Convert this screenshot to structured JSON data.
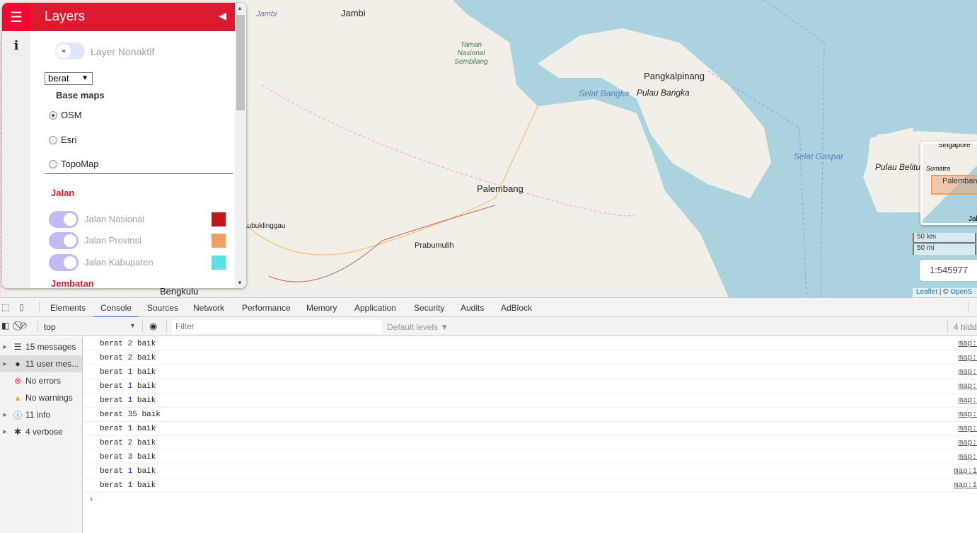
{
  "map": {
    "labels": {
      "jambi": "Jambi",
      "jambi2": "Jambi",
      "taman": "Taman Nasional Sembilang",
      "pangkalpinang": "Pangkalpinang",
      "pulau_bangka": "Pulau Bangka",
      "selat_bangka": "Selat Bangka",
      "selat_gaspar": "Selat Gaspar",
      "pulau_belitung": "Pulau Belitu",
      "palembang": "Palembang",
      "prabumulih": "Prabumulih",
      "lubuklinggau": "Lubuklinggau",
      "bengkulu": "Bengkulu"
    },
    "minimap": {
      "singapore": "Singapore",
      "sumatra": "Sumatra",
      "palembang": "Palemban",
      "jakarta": "Jak"
    },
    "scale": {
      "km": "50 km",
      "mi": "50 mi",
      "ratio": "1:545977"
    },
    "attribution": {
      "leaflet": "Leaflet",
      "sep": " | © ",
      "osm": "OpenS"
    },
    "colors": {
      "land": "#f2efe9",
      "sea": "#aad3df"
    }
  },
  "panel": {
    "title": "Layers",
    "menu_icon": "hamburger-icon",
    "info_icon": "info-icon",
    "collapse_icon": "caret-left-icon",
    "lock_label": "Layer Nonaktif",
    "select_value": "berat",
    "basemaps_title": "Base maps",
    "basemaps": [
      {
        "label": "OSM",
        "checked": true
      },
      {
        "label": "Esri",
        "checked": false
      },
      {
        "label": "TopoMap",
        "checked": false
      }
    ],
    "section_jalan": "Jalan",
    "layers": [
      {
        "label": "Jalan Nasional",
        "color": "#c0141a"
      },
      {
        "label": "Jalan Provinsi",
        "color": "#f0a060"
      },
      {
        "label": "Jalan Kabupaten",
        "color": "#5ce0e8"
      }
    ],
    "section_jembatan": "Jembatan",
    "accent": "#dc1a30"
  },
  "devtools": {
    "tabs": [
      "Elements",
      "Console",
      "Sources",
      "Network",
      "Performance",
      "Memory",
      "Application",
      "Security",
      "Audits",
      "AdBlock"
    ],
    "active_tab": "Console",
    "context": "top",
    "filter_placeholder": "Filter",
    "levels": "Default levels ▼",
    "hidden": "4 hidd",
    "sidebar": [
      {
        "label": "15 messages",
        "icon": "list-icon"
      },
      {
        "label": "11 user mes...",
        "icon": "user-icon"
      },
      {
        "label": "No errors",
        "icon": "error-icon"
      },
      {
        "label": "No warnings",
        "icon": "warning-icon"
      },
      {
        "label": "11 info",
        "icon": "info-icon"
      },
      {
        "label": "4 verbose",
        "icon": "bug-icon"
      }
    ],
    "logs": [
      {
        "a": "berat",
        "n": "2",
        "b": "baik",
        "src": "map:"
      },
      {
        "a": "berat",
        "n": "2",
        "b": "baik",
        "src": "map:"
      },
      {
        "a": "berat",
        "n": "1",
        "b": "baik",
        "src": "map:"
      },
      {
        "a": "berat",
        "n": "1",
        "b": "baik",
        "src": "map:"
      },
      {
        "a": "berat",
        "n": "1",
        "b": "baik",
        "src": "map:"
      },
      {
        "a": "berat",
        "n": "35",
        "b": "baik",
        "src": "map:"
      },
      {
        "a": "berat",
        "n": "1",
        "b": "baik",
        "src": "map:"
      },
      {
        "a": "berat",
        "n": "2",
        "b": "baik",
        "src": "map:"
      },
      {
        "a": "berat",
        "n": "3",
        "b": "baik",
        "src": "map:"
      },
      {
        "a": "berat",
        "n": "1",
        "b": "baik",
        "src": "map:1"
      },
      {
        "a": "berat",
        "n": "1",
        "b": "baik",
        "src": "map:1"
      }
    ],
    "prompt": "›"
  }
}
